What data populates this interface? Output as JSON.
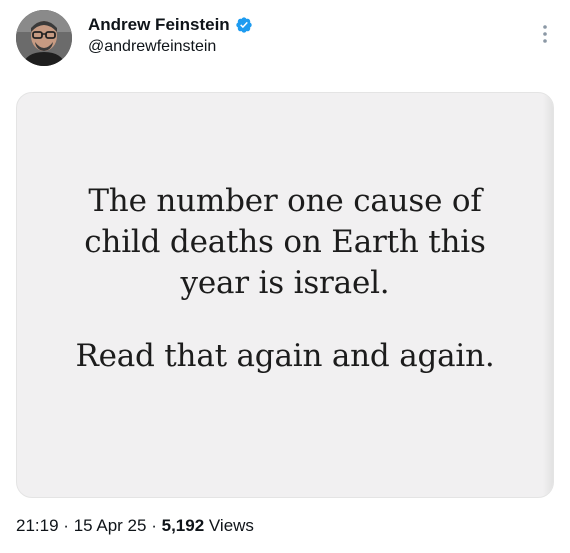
{
  "author": {
    "display_name": "Andrew Feinstein",
    "handle": "@andrewfeinstein",
    "verified": true
  },
  "post": {
    "image_text_lines": [
      "The number one cause of",
      "child deaths on Earth this",
      "year is israel.",
      "Read that again and again."
    ]
  },
  "meta": {
    "time": "21:19",
    "separator": "·",
    "date": "15 Apr 25",
    "views_count": "5,192",
    "views_label": "Views"
  },
  "colors": {
    "verified_blue": "#1d9bf0",
    "card_background": "#f1f0f1",
    "text": "#0f1419"
  },
  "icons": {
    "verified": "verified-badge-icon",
    "more": "more-vertical-icon"
  }
}
